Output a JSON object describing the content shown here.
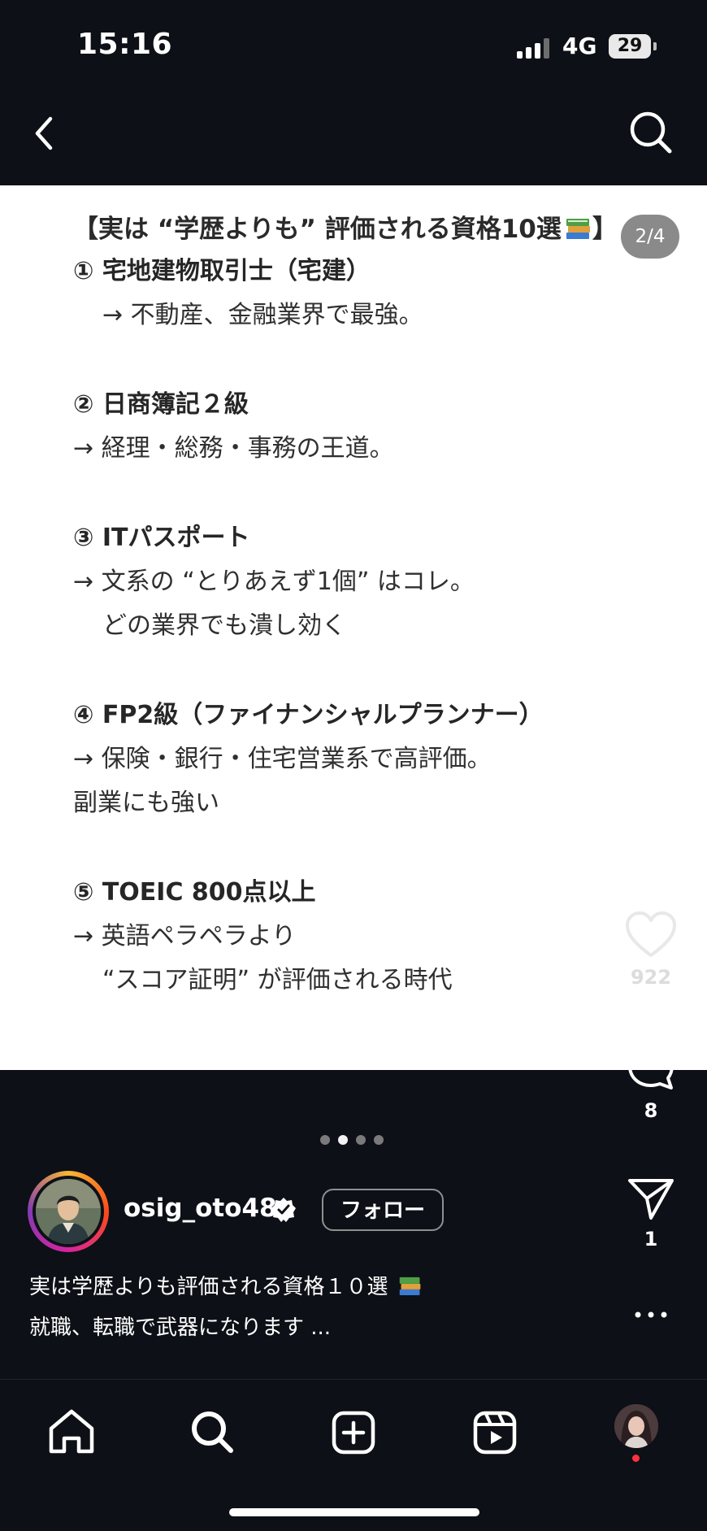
{
  "status_bar": {
    "time": "15:16",
    "network": "4G",
    "battery": "29"
  },
  "post": {
    "title": "【実は “学歴よりも” 評価される資格10選",
    "title_end": "】",
    "page_indicator": "2/4",
    "items": [
      {
        "heading": "① 宅地建物取引士（宅建）",
        "lines": [
          {
            "text": "→ 不動産、金融業界で最強。",
            "indent": true
          }
        ]
      },
      {
        "heading": "② 日商簿記２級",
        "lines": [
          {
            "text": "→ 経理・総務・事務の王道。",
            "indent": false
          }
        ]
      },
      {
        "heading": "③ ITパスポート",
        "lines": [
          {
            "text": "→ 文系の “とりあえず1個” はコレ。",
            "indent": false
          },
          {
            "text": "どの業界でも潰し効く",
            "indent": true
          }
        ]
      },
      {
        "heading": "④ FP2級（ファイナンシャルプランナー）",
        "lines": [
          {
            "text": "→ 保険・銀行・住宅営業系で高評価。",
            "indent": false
          },
          {
            "text": "副業にも強い",
            "indent": false
          }
        ]
      },
      {
        "heading": "⑤ TOEIC 800点以上",
        "lines": [
          {
            "text": "→ 英語ペラペラより",
            "indent": false
          },
          {
            "text": "“スコア証明” が評価される時代",
            "indent": true
          }
        ]
      }
    ]
  },
  "carousel": {
    "count": 4,
    "active": 1
  },
  "actions": {
    "likes": "922",
    "comments": "8",
    "shares": "1"
  },
  "author": {
    "username": "osig_oto48",
    "follow_label": "フォロー"
  },
  "caption": {
    "line1": "実は学歴よりも評価される資格１０選",
    "line2": "就職、転職で武器になります ..."
  },
  "icons": {
    "back": "chevron-left-icon",
    "search": "search-icon",
    "like": "heart-icon",
    "comment": "comment-icon",
    "share": "send-icon",
    "more": "more-icon",
    "home": "home-icon",
    "explore": "search-icon",
    "create": "plus-square-icon",
    "reels": "reels-icon",
    "verified": "verified-badge-icon",
    "book": "books-emoji-icon"
  },
  "colors": {
    "background": "#0d1016",
    "post_background": "#ffffff",
    "notification": "#ff3040"
  }
}
